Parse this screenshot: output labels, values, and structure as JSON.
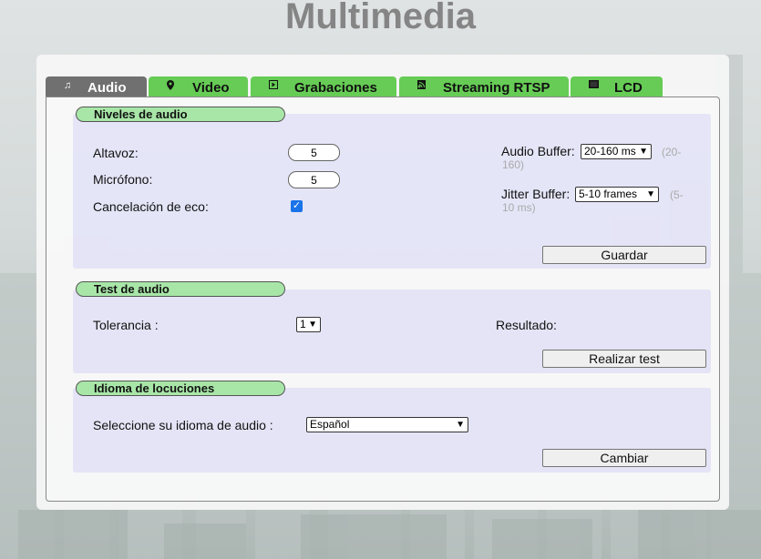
{
  "page": {
    "title": "Multimedia"
  },
  "tabs": [
    {
      "label": "Audio",
      "icon": "music-note-icon",
      "active": true
    },
    {
      "label": "Video",
      "icon": "location-pin-icon",
      "active": false
    },
    {
      "label": "Grabaciones",
      "icon": "play-icon",
      "active": false
    },
    {
      "label": "Streaming RTSP",
      "icon": "feed-icon",
      "active": false
    },
    {
      "label": "LCD",
      "icon": "screen-icon",
      "active": false
    }
  ],
  "niveles": {
    "header": "Niveles de audio",
    "altavoz_label": "Altavoz:",
    "altavoz_value": "5",
    "microfono_label": "Micrófono:",
    "microfono_value": "5",
    "eco_label": "Cancelación de eco:",
    "eco_checked": true,
    "audio_buffer_label": "Audio Buffer:",
    "audio_buffer_value": "20-160 ms",
    "audio_buffer_hint": "(20-160)",
    "jitter_buffer_label": "Jitter Buffer:",
    "jitter_buffer_value": "5-10 frames",
    "jitter_buffer_hint": "(5-10 ms)",
    "save_button": "Guardar"
  },
  "test": {
    "header": "Test de audio",
    "tolerancia_label": "Tolerancia :",
    "tolerancia_value": "1",
    "resultado_label": "Resultado:",
    "run_button": "Realizar test"
  },
  "idioma": {
    "header": "Idioma de locuciones",
    "select_label": "Seleccione su idioma de audio :",
    "select_value": "Español",
    "change_button": "Cambiar"
  },
  "colors": {
    "tab_active": "#707070",
    "tab_inactive": "#66cc55",
    "section_header": "#a8e6a8",
    "section_bg": "#d5d5f5",
    "title": "#858585"
  }
}
